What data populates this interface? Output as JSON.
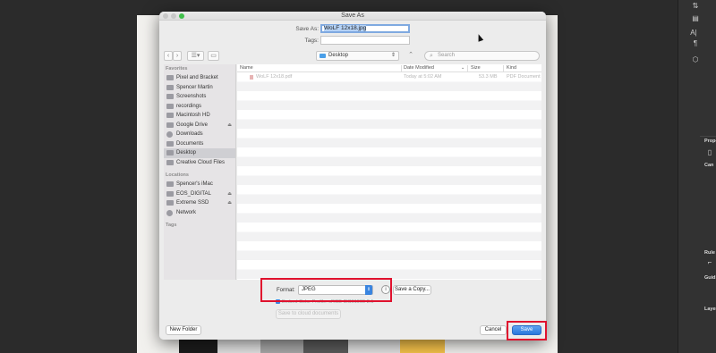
{
  "dialog": {
    "title": "Save As",
    "save_as_label": "Save As:",
    "save_as_value": "WoLF 12x18.jpg",
    "tags_label": "Tags:",
    "tags_value": ""
  },
  "toolbar": {
    "back_icon": "chevron-left-icon",
    "forward_icon": "chevron-right-icon",
    "view_icon": "list-view-icon",
    "new_folder_icon": "folder-icon",
    "location": "Desktop",
    "search_placeholder": "Search"
  },
  "sidebar": {
    "favorites_header": "Favorites",
    "favorites": [
      {
        "label": "Pixel and Bracket",
        "icon": "folder-icon"
      },
      {
        "label": "Spencer Martin",
        "icon": "home-icon"
      },
      {
        "label": "Screenshots",
        "icon": "folder-icon"
      },
      {
        "label": "recordings",
        "icon": "folder-icon"
      },
      {
        "label": "Macintosh HD",
        "icon": "drive-icon"
      },
      {
        "label": "Google Drive",
        "icon": "drive-icon"
      },
      {
        "label": "Downloads",
        "icon": "downloads-icon"
      },
      {
        "label": "Documents",
        "icon": "folder-icon"
      },
      {
        "label": "Desktop",
        "icon": "folder-icon",
        "selected": true
      },
      {
        "label": "Creative Cloud Files",
        "icon": "folder-icon"
      }
    ],
    "locations_header": "Locations",
    "locations": [
      {
        "label": "Spencer's iMac",
        "icon": "computer-icon"
      },
      {
        "label": "EOS_DIGITAL",
        "icon": "drive-icon"
      },
      {
        "label": "Extreme SSD",
        "icon": "drive-icon"
      },
      {
        "label": "Network",
        "icon": "network-icon"
      }
    ],
    "tags_header": "Tags"
  },
  "filelist": {
    "columns": [
      "Name",
      "Date Modified",
      "Size",
      "Kind"
    ],
    "rows": [
      {
        "name": "WoLF 12x18.pdf",
        "date": "Today at 5:02 AM",
        "size": "53.3 MB",
        "kind": "PDF Document"
      }
    ]
  },
  "bottom": {
    "format_label": "Format:",
    "format_value": "JPEG",
    "save_copy_label": "Save a Copy...",
    "embed_label": "Embed Color Profile: sRGB IEC61966-2.1",
    "cloud_label": "Save to cloud documents",
    "new_folder_label": "New Folder",
    "cancel_label": "Cancel",
    "save_label": "Save"
  },
  "colors": {
    "accent": "#3a85e0",
    "highlight": "#e0122e"
  }
}
